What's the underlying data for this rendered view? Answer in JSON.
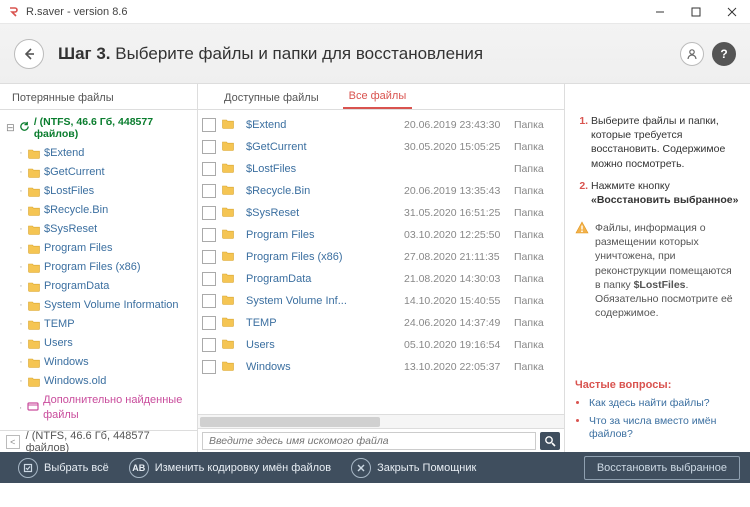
{
  "window": {
    "title": "R.saver - version 8.6"
  },
  "header": {
    "step_bold": "Шаг 3.",
    "step_rest": " Выберите файлы и папки для восстановления"
  },
  "tabs": {
    "lost": "Потерянные файлы",
    "available": "Доступные файлы",
    "all": "Все файлы"
  },
  "tree": {
    "root": "/ (NTFS, 46.6 Гб, 448577 файлов)",
    "items": [
      {
        "label": "$Extend"
      },
      {
        "label": "$GetCurrent"
      },
      {
        "label": "$LostFiles"
      },
      {
        "label": "$Recycle.Bin"
      },
      {
        "label": "$SysReset"
      },
      {
        "label": "Program Files"
      },
      {
        "label": "Program Files (x86)"
      },
      {
        "label": "ProgramData"
      },
      {
        "label": "System Volume Information"
      },
      {
        "label": "TEMP"
      },
      {
        "label": "Users"
      },
      {
        "label": "Windows"
      },
      {
        "label": "Windows.old"
      }
    ],
    "extra": "Дополнительно найденные файлы"
  },
  "status_path": "/ (NTFS, 46.6 Гб, 448577 файлов)",
  "files": [
    {
      "name": "$Extend",
      "date": "20.06.2019 23:43:30",
      "type": "Папка"
    },
    {
      "name": "$GetCurrent",
      "date": "30.05.2020 15:05:25",
      "type": "Папка"
    },
    {
      "name": "$LostFiles",
      "date": "",
      "type": "Папка"
    },
    {
      "name": "$Recycle.Bin",
      "date": "20.06.2019 13:35:43",
      "type": "Папка"
    },
    {
      "name": "$SysReset",
      "date": "31.05.2020 16:51:25",
      "type": "Папка"
    },
    {
      "name": "Program Files",
      "date": "03.10.2020 12:25:50",
      "type": "Папка"
    },
    {
      "name": "Program Files (x86)",
      "date": "27.08.2020 21:11:35",
      "type": "Папка"
    },
    {
      "name": "ProgramData",
      "date": "21.08.2020 14:30:03",
      "type": "Папка"
    },
    {
      "name": "System Volume Inf...",
      "date": "14.10.2020 15:40:55",
      "type": "Папка"
    },
    {
      "name": "TEMP",
      "date": "24.06.2020 14:37:49",
      "type": "Папка"
    },
    {
      "name": "Users",
      "date": "05.10.2020 19:16:54",
      "type": "Папка"
    },
    {
      "name": "Windows",
      "date": "13.10.2020 22:05:37",
      "type": "Папка"
    }
  ],
  "search": {
    "placeholder": "Введите здесь имя искомого файла"
  },
  "info": {
    "step1_a": "Выберите файлы и папки, которые требуется восстановить. Содержимое можно посмотреть.",
    "step2_a": "Нажмите кнопку ",
    "step2_b": "«Восстановить выбранное»",
    "warn_a": "Файлы, информация о размещении которых уничтожена, при реконструкции помещаются в папку ",
    "warn_b": "$LostFiles",
    "warn_c": ". Обязательно посмотрите её содержимое."
  },
  "faq": {
    "title": "Частые вопросы:",
    "q1": "Как здесь найти файлы?",
    "q2": "Что за числа вместо имён файлов?"
  },
  "footer": {
    "select_all": "Выбрать всё",
    "encoding": "Изменить кодировку имён файлов",
    "close": "Закрыть Помощник",
    "restore": "Восстановить выбранное"
  }
}
